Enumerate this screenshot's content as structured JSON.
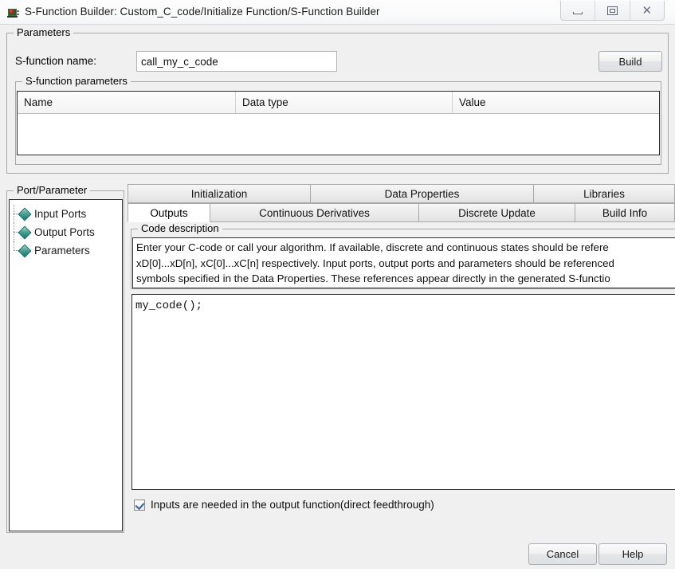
{
  "window": {
    "title": "S-Function Builder: Custom_C_code/Initialize Function/S-Function Builder",
    "app_icon": "simulink-block-icon",
    "controls": {
      "minimize": "minimize-icon",
      "maximize": "restore-icon",
      "close": "close-icon",
      "close_glyph": "✕"
    }
  },
  "parameters_group": {
    "title": "Parameters",
    "sfunction_name_label": "S-function name:",
    "sfunction_name_value": "call_my_c_code",
    "sfunction_name_placeholder": "",
    "build_button": "Build",
    "sfunction_parameters": {
      "title": "S-function parameters",
      "columns": [
        "Name",
        "Data type",
        "Value"
      ],
      "rows": [],
      "delete_button_glyph": "☒"
    }
  },
  "port_parameter_group": {
    "title": "Port/Parameter",
    "items": [
      {
        "label": "Input Ports",
        "icon": "diamond-icon"
      },
      {
        "label": "Output Ports",
        "icon": "diamond-icon"
      },
      {
        "label": "Parameters",
        "icon": "diamond-icon"
      }
    ]
  },
  "tabs": {
    "top_row": [
      {
        "label": "Initialization",
        "active": false
      },
      {
        "label": "Data Properties",
        "active": false
      },
      {
        "label": "Libraries",
        "active": false
      }
    ],
    "bottom_row": [
      {
        "label": "Outputs",
        "active": true
      },
      {
        "label": "Continuous Derivatives",
        "active": false
      },
      {
        "label": "Discrete Update",
        "active": false
      },
      {
        "label": "Build Info",
        "active": false
      }
    ]
  },
  "outputs_tab": {
    "code_description": {
      "title": "Code description",
      "text": "Enter your C-code or call your algorithm. If available, discrete and continuous states should be refere\nxD[0]...xD[n], xC[0]...xC[n] respectively. Input ports, output ports and parameters should be referenced\nsymbols specified in the Data Properties. These references appear directly in the generated S-functio"
    },
    "code_editor": {
      "value": "my_code();",
      "placeholder": ""
    },
    "direct_feedthrough": {
      "label": "Inputs are needed in the output function(direct feedthrough)",
      "checked": true
    }
  },
  "footer": {
    "cancel_button": "Cancel",
    "help_button": "Help"
  },
  "colors": {
    "dialog_background": "#f0f0f0",
    "field_background": "#ffffff",
    "group_border": "#a8a8a8",
    "strong_border": "#2b2b2b",
    "tree_diamond": "#13776b",
    "checkmark": "#2b5fa8",
    "titlebar": "#fbfbfc"
  }
}
